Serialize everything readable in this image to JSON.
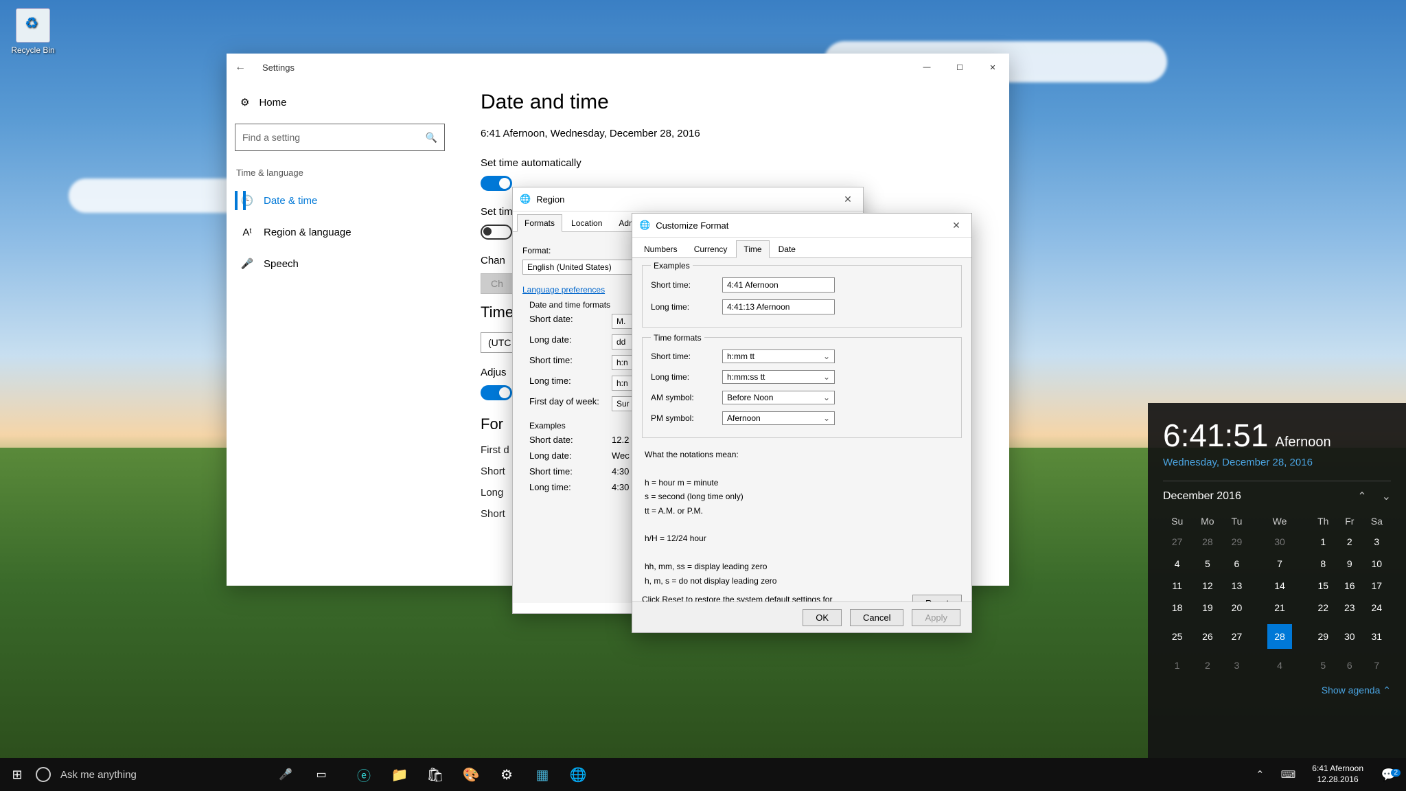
{
  "desktop": {
    "recycle_bin": "Recycle Bin"
  },
  "settings": {
    "title": "Settings",
    "home": "Home",
    "search_placeholder": "Find a setting",
    "category": "Time & language",
    "nav": {
      "date": "Date & time",
      "region": "Region & language",
      "speech": "Speech"
    },
    "page_title": "Date and time",
    "now": "6:41 Afernoon, Wednesday, December 28, 2016",
    "auto_time": "Set time automatically",
    "auto_tz_partial": "Set tim",
    "change_hdr": "Chan",
    "change_btn": "Ch",
    "tz_hdr": "Time z",
    "tz_value": "(UTC",
    "adjust": "Adjus",
    "formats_hdr": "For",
    "first_partial": "First d",
    "short_partial": "Short",
    "long_partial": "Long",
    "short2_partial": "Short"
  },
  "region": {
    "title": "Region",
    "tabs": {
      "formats": "Formats",
      "location": "Location",
      "admin": "Administrat"
    },
    "format_lbl": "Format:",
    "format_val": "English (United States)",
    "lang_link": "Language preferences",
    "dt_hdr": "Date and time formats",
    "rows": {
      "short_date": {
        "l": "Short date:",
        "v": "M."
      },
      "long_date": {
        "l": "Long date:",
        "v": "dd"
      },
      "short_time": {
        "l": "Short time:",
        "v": "h:n"
      },
      "long_time": {
        "l": "Long time:",
        "v": "h:n"
      },
      "first_day": {
        "l": "First day of week:",
        "v": "Sur"
      }
    },
    "ex_hdr": "Examples",
    "ex": {
      "short_date": {
        "l": "Short date:",
        "v": "12.2"
      },
      "long_date": {
        "l": "Long date:",
        "v": "Wec"
      },
      "short_time": {
        "l": "Short time:",
        "v": "4:30"
      },
      "long_time": {
        "l": "Long time:",
        "v": "4:30"
      }
    }
  },
  "customize": {
    "title": "Customize Format",
    "tabs": {
      "numbers": "Numbers",
      "currency": "Currency",
      "time": "Time",
      "date": "Date"
    },
    "examples_legend": "Examples",
    "ex_short": {
      "l": "Short time:",
      "v": "4:41 Afernoon"
    },
    "ex_long": {
      "l": "Long time:",
      "v": "4:41:13 Afernoon"
    },
    "formats_legend": "Time formats",
    "fmt_short": {
      "l": "Short time:",
      "v": "h:mm tt"
    },
    "fmt_long": {
      "l": "Long time:",
      "v": "h:mm:ss tt"
    },
    "am": {
      "l": "AM symbol:",
      "v": "Before Noon"
    },
    "pm": {
      "l": "PM symbol:",
      "v": "Afernoon"
    },
    "notation_hdr": "What the notations mean:",
    "notation1": "h = hour   m = minute",
    "notation2": "s = second (long time only)",
    "notation3": "tt = A.M. or P.M.",
    "notation4": "h/H = 12/24 hour",
    "notation5": "hh, mm, ss  =  display leading zero",
    "notation6": "h, m, s  =  do not display leading zero",
    "reset_hint": "Click Reset to restore the system default settings for numbers, currency, time, and date.",
    "reset": "Reset",
    "ok": "OK",
    "cancel": "Cancel",
    "apply": "Apply"
  },
  "flyout": {
    "time": "6:41:51",
    "suffix": "Afernoon",
    "date": "Wednesday, December 28, 2016",
    "month": "December 2016",
    "dow": [
      "Su",
      "Mo",
      "Tu",
      "We",
      "Th",
      "Fr",
      "Sa"
    ],
    "weeks": [
      [
        {
          "d": "27",
          "dim": true
        },
        {
          "d": "28",
          "dim": true
        },
        {
          "d": "29",
          "dim": true
        },
        {
          "d": "30",
          "dim": true
        },
        {
          "d": "1"
        },
        {
          "d": "2"
        },
        {
          "d": "3"
        }
      ],
      [
        {
          "d": "4"
        },
        {
          "d": "5"
        },
        {
          "d": "6"
        },
        {
          "d": "7"
        },
        {
          "d": "8"
        },
        {
          "d": "9"
        },
        {
          "d": "10"
        }
      ],
      [
        {
          "d": "11"
        },
        {
          "d": "12"
        },
        {
          "d": "13"
        },
        {
          "d": "14"
        },
        {
          "d": "15"
        },
        {
          "d": "16"
        },
        {
          "d": "17"
        }
      ],
      [
        {
          "d": "18"
        },
        {
          "d": "19"
        },
        {
          "d": "20"
        },
        {
          "d": "21"
        },
        {
          "d": "22"
        },
        {
          "d": "23"
        },
        {
          "d": "24"
        }
      ],
      [
        {
          "d": "25"
        },
        {
          "d": "26"
        },
        {
          "d": "27"
        },
        {
          "d": "28",
          "today": true
        },
        {
          "d": "29"
        },
        {
          "d": "30"
        },
        {
          "d": "31"
        }
      ],
      [
        {
          "d": "1",
          "dim": true
        },
        {
          "d": "2",
          "dim": true
        },
        {
          "d": "3",
          "dim": true
        },
        {
          "d": "4",
          "dim": true
        },
        {
          "d": "5",
          "dim": true
        },
        {
          "d": "6",
          "dim": true
        },
        {
          "d": "7",
          "dim": true
        }
      ]
    ],
    "agenda": "Show agenda  ⌃"
  },
  "taskbar": {
    "search": "Ask me anything",
    "clock_time": "6:41 Afernoon",
    "clock_date": "12.28.2016",
    "notif_count": "2"
  }
}
